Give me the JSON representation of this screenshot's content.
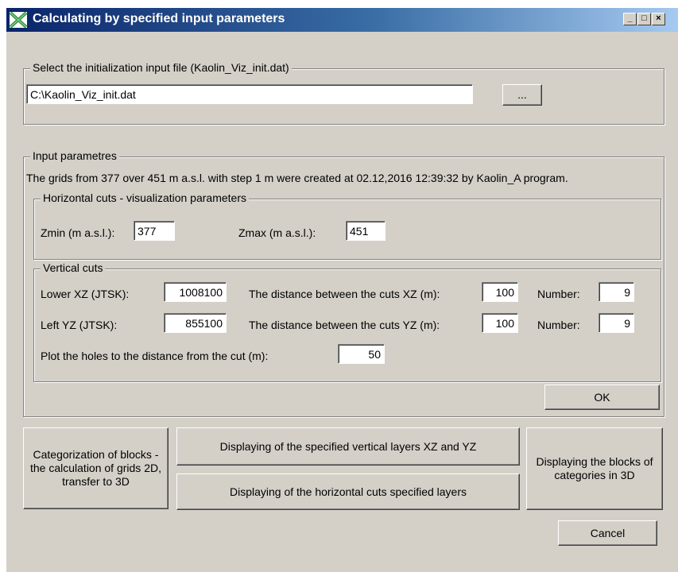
{
  "window": {
    "title": "Calculating by specified input parameters",
    "icon": "kaolin-app-icon",
    "caption_buttons": {
      "minimize": "_",
      "maximize": "□",
      "close": "×"
    }
  },
  "file_group": {
    "legend": "Select the initialization input file (Kaolin_Viz_init.dat)",
    "path_value": "C:\\Kaolin_Viz_init.dat",
    "browse_label": "..."
  },
  "input_group": {
    "legend": "Input parametres",
    "info_text": "The grids from 377 over 451 m a.s.l. with step 1 m were created at 02.12,2016 12:39:32 by Kaolin_A program.",
    "ok_label": "OK"
  },
  "horizontal": {
    "legend": "Horizontal cuts - visualization parameters",
    "zmin_label": "Zmin (m a.s.l.):",
    "zmin_value": "377",
    "zmax_label": "Zmax (m a.s.l.):",
    "zmax_value": "451"
  },
  "vertical": {
    "legend": "Vertical cuts",
    "lower_xz_label": "Lower XZ (JTSK):",
    "lower_xz_value": "1008100",
    "dist_xz_label": "The distance between the cuts XZ (m):",
    "dist_xz_value": "100",
    "number_xz_label": "Number:",
    "number_xz_value": "9",
    "left_yz_label": "Left YZ (JTSK):",
    "left_yz_value": "855100",
    "dist_yz_label": "The distance between the cuts YZ (m):",
    "dist_yz_value": "100",
    "number_yz_label": "Number:",
    "number_yz_value": "9",
    "holes_label": "Plot the holes to the distance from the cut (m):",
    "holes_value": "50"
  },
  "actions": {
    "categorization_label": "Categorization of blocks - the calculation of grids 2D, transfer to 3D",
    "vertical_layers_label": "Displaying of the specified vertical layers XZ and YZ",
    "horizontal_layers_label": "Displaying  of the horizontal cuts specified layers",
    "blocks_3d_label": "Displaying the blocks of categories in 3D",
    "cancel_label": "Cancel"
  }
}
